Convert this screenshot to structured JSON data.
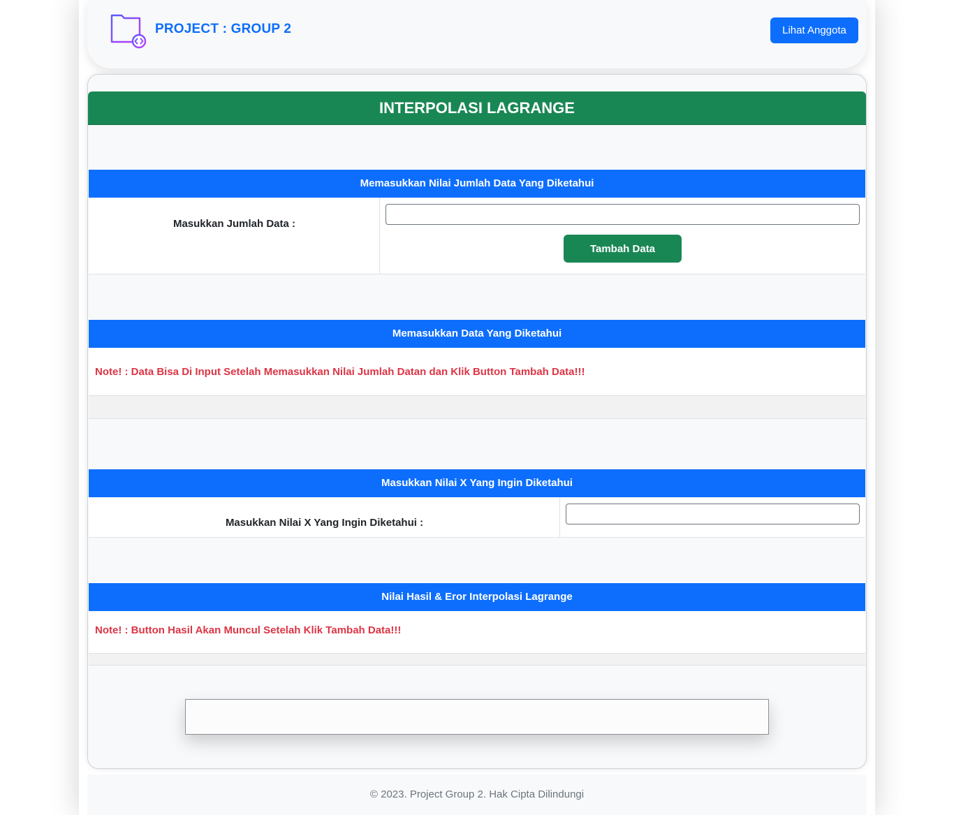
{
  "header": {
    "brand": "PROJECT : GROUP 2",
    "members_button": "Lihat Anggota"
  },
  "card": {
    "title": "INTERPOLASI LAGRANGE"
  },
  "section_count": {
    "heading": "Memasukkan Nilai Jumlah Data Yang Diketahui",
    "label": "Masukkan Jumlah Data :",
    "input_value": "",
    "add_button": "Tambah Data"
  },
  "section_data": {
    "heading": "Memasukkan Data Yang Diketahui",
    "note": "Note! : Data Bisa Di Input Setelah Memasukkan Nilai Jumlah Datan dan Klik Button Tambah Data!!!"
  },
  "section_x": {
    "heading": "Masukkan Nilai X Yang Ingin Diketahui",
    "label": "Masukkan Nilai X Yang Ingin Diketahui :",
    "input_value": ""
  },
  "section_result": {
    "heading": "Nilai Hasil & Eror Interpolasi Lagrange",
    "note": "Note! : Button Hasil Akan Muncul Setelah Klik Tambah Data!!!"
  },
  "footer": {
    "text": "© 2023. Project Group 2. Hak Cipta Dilindungi"
  },
  "colors": {
    "primary": "#0d6efd",
    "success": "#198754",
    "danger": "#dc3545",
    "logo_purple": "#8b3dff"
  },
  "icons": {
    "brand_logo": "code-folder-icon"
  }
}
